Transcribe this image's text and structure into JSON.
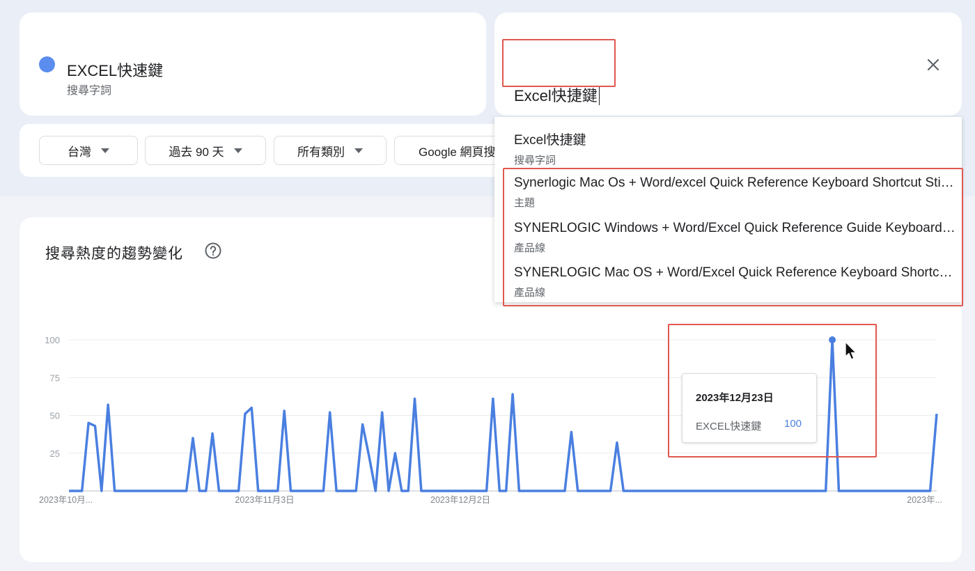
{
  "term_card": {
    "name": "EXCEL快速鍵",
    "type": "搜尋字詞",
    "color": "#5b8def"
  },
  "search": {
    "value": "Excel快捷鍵",
    "close_icon": "close-icon"
  },
  "filters": [
    {
      "label": "台灣"
    },
    {
      "label": "過去 90 天"
    },
    {
      "label": "所有類別"
    },
    {
      "label": "Google 網頁搜"
    }
  ],
  "suggestions": [
    {
      "title": "Excel快捷鍵",
      "type": "搜尋字詞"
    },
    {
      "title": "Synerlogic Mac Os + Word/excel Quick Reference Keyboard Shortcut Sticker",
      "type": "主題"
    },
    {
      "title": "SYNERLOGIC Windows + Word/Excel Quick Reference Guide Keyboard Sticker",
      "type": "產品線"
    },
    {
      "title": "SYNERLOGIC Mac OS + Word/Excel Quick Reference Keyboard Shortcut Sticker",
      "type": "產品線"
    }
  ],
  "chart_section": {
    "title": "搜尋熱度的趨勢變化",
    "help_icon": "help-circle-icon"
  },
  "tooltip": {
    "date": "2023年12月23日",
    "term": "EXCEL快速鍵",
    "value": "100"
  },
  "chart_data": {
    "type": "line",
    "ylim": [
      0,
      100
    ],
    "yticks": [
      25,
      50,
      75,
      100
    ],
    "xtick_labels": [
      "2023年10月...",
      "2023年11月3日",
      "2023年12月2日",
      "2023年..."
    ],
    "xtick_index": [
      0,
      30,
      60,
      89
    ],
    "series": [
      {
        "name": "EXCEL快速鍵",
        "color": "#4a7fe0",
        "values": [
          0,
          0,
          0,
          45,
          43,
          0,
          57,
          0,
          0,
          0,
          0,
          0,
          0,
          0,
          0,
          0,
          0,
          0,
          0,
          35,
          0,
          0,
          38,
          0,
          0,
          0,
          0,
          51,
          55,
          0,
          0,
          0,
          0,
          53,
          0,
          0,
          0,
          0,
          0,
          0,
          52,
          0,
          0,
          0,
          0,
          44,
          23,
          0,
          52,
          0,
          25,
          0,
          0,
          61,
          0,
          0,
          0,
          0,
          0,
          0,
          0,
          0,
          0,
          0,
          0,
          61,
          0,
          0,
          64,
          0,
          0,
          0,
          0,
          0,
          0,
          0,
          0,
          39,
          0,
          0,
          0,
          0,
          0,
          0,
          32,
          0,
          0,
          0,
          0,
          0,
          0,
          0,
          0,
          0,
          0,
          0,
          0,
          0,
          0,
          0,
          0,
          0,
          0,
          0,
          0,
          0,
          0,
          0,
          0,
          0,
          0,
          0,
          0,
          0,
          0,
          0,
          0,
          100,
          0,
          0,
          0,
          0,
          0,
          0,
          0,
          0,
          0,
          0,
          0,
          0,
          0,
          0,
          0,
          51
        ]
      }
    ],
    "highlight": {
      "date": "2023年12月23日",
      "value": 100
    }
  }
}
